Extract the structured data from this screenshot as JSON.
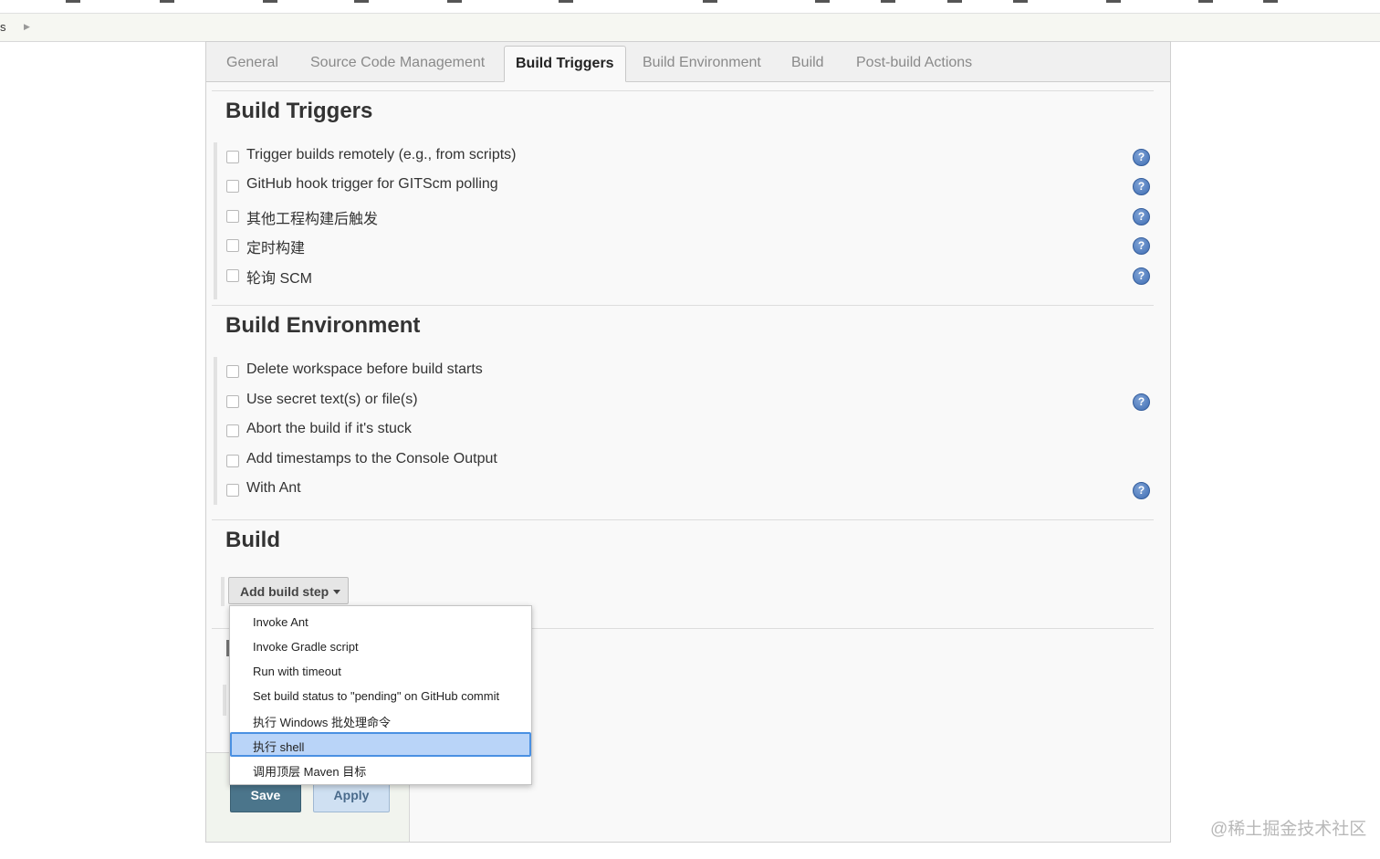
{
  "breadcrumb": {
    "fragment": "s"
  },
  "tabs": [
    {
      "label": "General",
      "active": false
    },
    {
      "label": "Source Code Management",
      "active": false
    },
    {
      "label": "Build Triggers",
      "active": true
    },
    {
      "label": "Build Environment",
      "active": false
    },
    {
      "label": "Build",
      "active": false
    },
    {
      "label": "Post-build Actions",
      "active": false
    }
  ],
  "build_triggers": {
    "title": "Build Triggers",
    "options": [
      {
        "label": "Trigger builds remotely (e.g., from scripts)",
        "checked": false,
        "help": true
      },
      {
        "label": "GitHub hook trigger for GITScm polling",
        "checked": false,
        "help": true
      },
      {
        "label": "其他工程构建后触发",
        "checked": false,
        "help": true
      },
      {
        "label": "定时构建",
        "checked": false,
        "help": true
      },
      {
        "label": "轮询 SCM",
        "checked": false,
        "help": true
      }
    ]
  },
  "build_environment": {
    "title": "Build Environment",
    "options": [
      {
        "label": "Delete workspace before build starts",
        "checked": false,
        "help": false
      },
      {
        "label": "Use secret text(s) or file(s)",
        "checked": false,
        "help": true
      },
      {
        "label": "Abort the build if it's stuck",
        "checked": false,
        "help": false
      },
      {
        "label": "Add timestamps to the Console Output",
        "checked": false,
        "help": false
      },
      {
        "label": "With Ant",
        "checked": false,
        "help": true
      }
    ]
  },
  "build": {
    "title": "Build",
    "add_step_label": "Add build step",
    "dropdown_items": [
      {
        "label": "Invoke Ant",
        "selected": false
      },
      {
        "label": "Invoke Gradle script",
        "selected": false
      },
      {
        "label": "Run with timeout",
        "selected": false
      },
      {
        "label": "Set build status to \"pending\" on GitHub commit",
        "selected": false
      },
      {
        "label": "执行 Windows 批处理命令",
        "selected": false
      },
      {
        "label": "执行 shell",
        "selected": true
      },
      {
        "label": "调用顶层 Maven 目标",
        "selected": false
      }
    ]
  },
  "buttons": {
    "save": "Save",
    "apply": "Apply"
  },
  "help_glyph": "?",
  "watermark": "@稀土掘金技术社区",
  "colors": {
    "save_bg": "#4b758b",
    "apply_bg": "#cfe0f2",
    "selected_item_bg": "#b9d4f8",
    "selected_item_border": "#4a90e2",
    "help_icon": "#3f6db3"
  }
}
